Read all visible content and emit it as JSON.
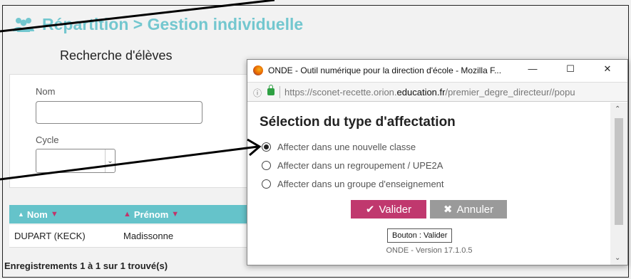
{
  "page": {
    "title": "Répartition > Gestion individuelle",
    "search_title": "Recherche d'élèves",
    "nom_label": "Nom",
    "nom_value": "",
    "cycle_label": "Cycle",
    "cycle_value": ""
  },
  "table": {
    "headers": [
      "Nom",
      "Prénom"
    ],
    "rows": [
      {
        "nom": "DUPART (KECK)",
        "prenom": "Madissonne"
      }
    ],
    "footer": "Enregistrements 1 à 1 sur 1 trouvé(s)"
  },
  "popup": {
    "window_title": "ONDE - Outil numérique pour la direction d'école - Mozilla F...",
    "url_prefix": "https://sconet-recette.orion.",
    "url_domain": "education.fr",
    "url_suffix": "/premier_degre_directeur//popu",
    "heading": "Sélection du type d'affectation",
    "options": [
      {
        "label": "Affecter dans une nouvelle classe",
        "checked": true
      },
      {
        "label": "Affecter dans un regroupement / UPE2A",
        "checked": false
      },
      {
        "label": "Affecter dans un groupe d'enseignement",
        "checked": false
      }
    ],
    "valider_label": "Valider",
    "annuler_label": "Annuler",
    "tooltip": "Bouton : Valider",
    "version": "ONDE - Version 17.1.0.5"
  },
  "colors": {
    "accent_teal": "#65c3ca",
    "valider": "#c0386e",
    "annuler": "#9a9a9a"
  }
}
